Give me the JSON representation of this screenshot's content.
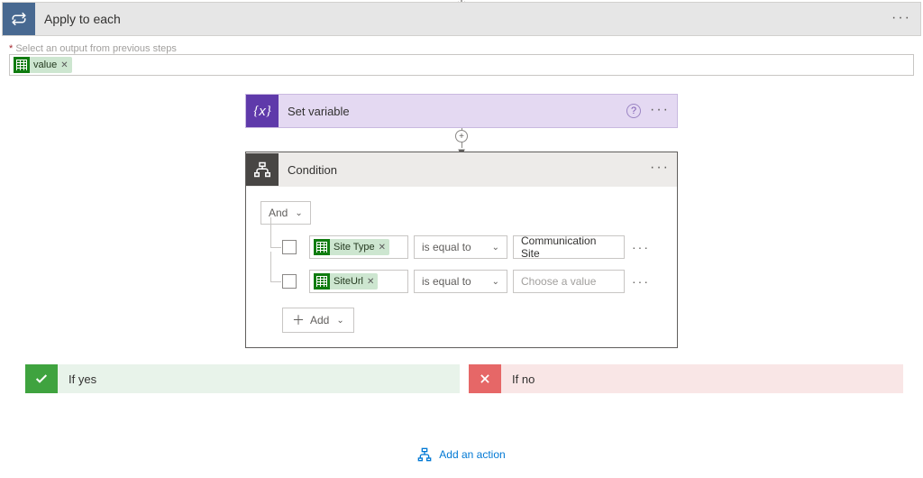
{
  "apply_each": {
    "title": "Apply to each"
  },
  "select_output": {
    "label": "Select an output from previous steps",
    "token": "value"
  },
  "set_variable": {
    "title": "Set variable"
  },
  "condition": {
    "title": "Condition",
    "group_op": "And",
    "add_label": "Add",
    "rows": [
      {
        "field": "Site Type",
        "op": "is equal to",
        "value": "Communication Site",
        "placeholder": ""
      },
      {
        "field": "SiteUrl",
        "op": "is equal to",
        "value": "",
        "placeholder": "Choose a value"
      }
    ]
  },
  "branches": {
    "yes": "If yes",
    "no": "If no"
  },
  "add_action": {
    "label": "Add an action"
  }
}
